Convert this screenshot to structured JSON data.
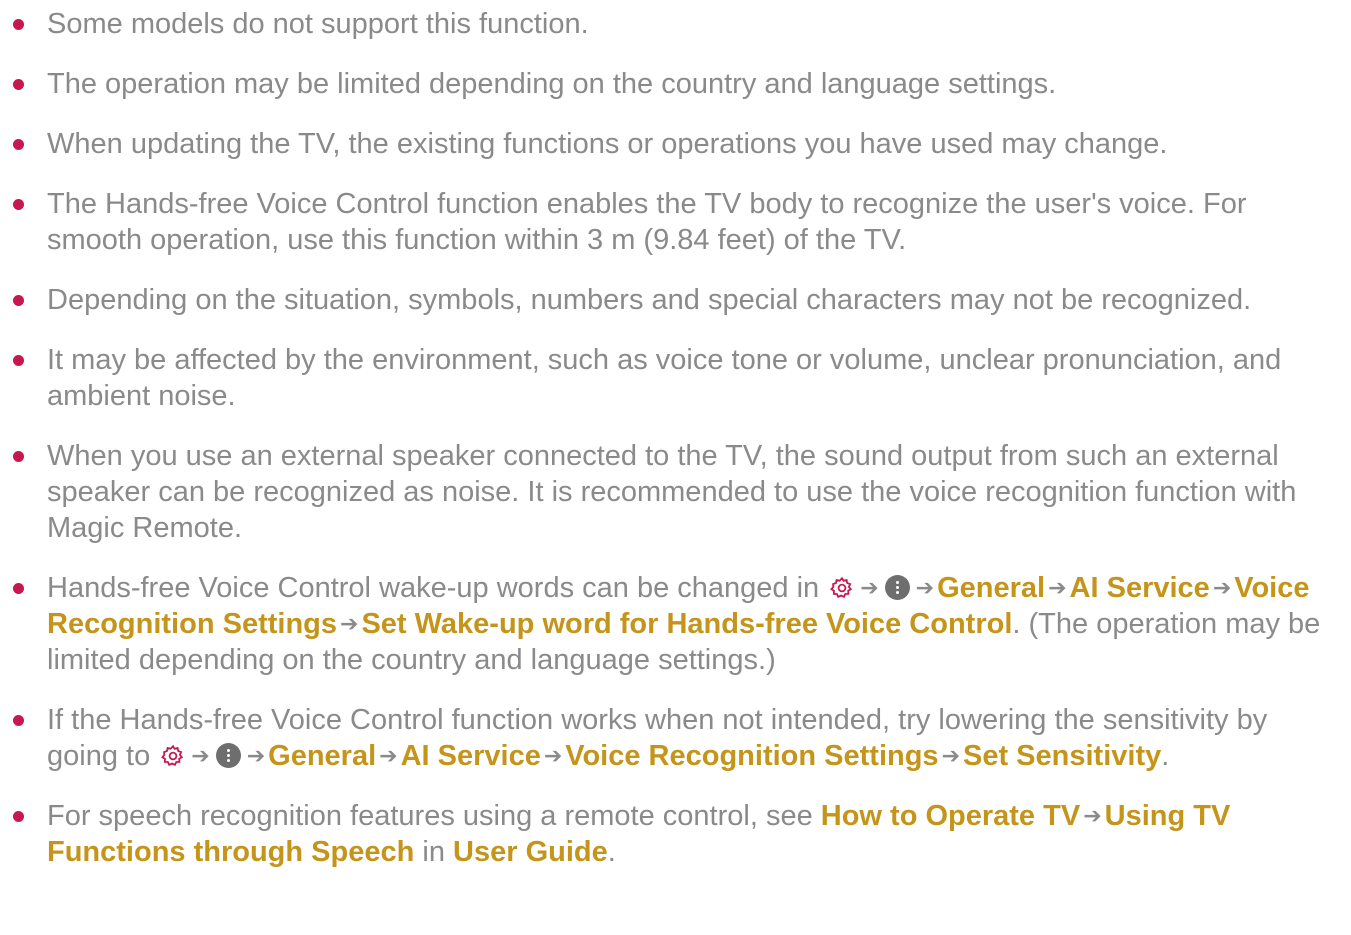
{
  "colors": {
    "text": "#8a8a8a",
    "highlight": "#c4951a",
    "bullet": "#c8174f"
  },
  "icons": {
    "settings": "gear-icon",
    "more": "more-options-icon",
    "arrow": "arrow-right-icon"
  },
  "notes": [
    {
      "text": "Some models do not support this function."
    },
    {
      "text": "The operation may be limited depending on the country and language settings."
    },
    {
      "text": "When updating the TV, the existing functions or operations you have used may change."
    },
    {
      "text": "The Hands-free Voice Control function enables the TV body to recognize the user's voice. For smooth operation, use this function within 3 m (9.84 feet) of the TV."
    },
    {
      "text": "Depending on the situation, symbols, numbers and special characters may not be recognized."
    },
    {
      "text": "It may be affected by the environment, such as voice tone or volume, unclear pronunciation, and ambient noise."
    },
    {
      "text": "When you use an external speaker connected to the TV, the sound output from such an external speaker can be recognized as noise. It is recommended to use the voice recognition function with Magic Remote."
    },
    {
      "intro": "Hands-free Voice Control wake-up words can be changed in",
      "path": [
        "General",
        "AI Service",
        "Voice Recognition Settings",
        "Set Wake-up word for Hands-free Voice Control"
      ],
      "outro": ". (The operation may be limited depending on the country and language settings.)"
    },
    {
      "intro": "If the Hands-free Voice Control function works when not intended, try lowering the sensitivity by going to",
      "path": [
        "General",
        "AI Service",
        "Voice Recognition Settings",
        "Set Sensitivity"
      ],
      "outro": "."
    },
    {
      "intro": "For speech recognition features using a remote control, see",
      "path": [
        "How to Operate TV",
        "Using TV Functions through Speech"
      ],
      "middle": "in",
      "guide": "User Guide",
      "outro": "."
    }
  ]
}
